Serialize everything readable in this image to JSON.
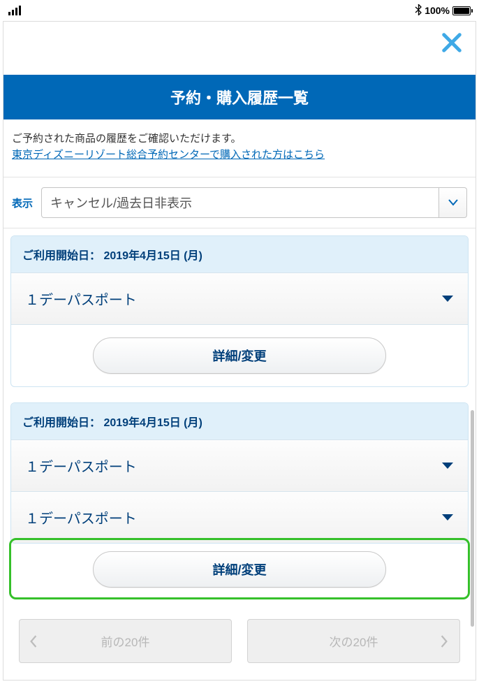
{
  "status": {
    "battery_text": "100%"
  },
  "header": {
    "title": "予約・購入履歴一覧"
  },
  "intro": {
    "text": "ご予約された商品の履歴をご確認いただけます。",
    "link": "東京ディズニーリゾート総合予約センターで購入された方はこちら"
  },
  "filter": {
    "label": "表示",
    "selected": "キャンセル/過去日非表示"
  },
  "bookings": [
    {
      "date_label": "ご利用開始日： 2019年4月15日 (月)",
      "items": [
        "１デーパスポート"
      ],
      "action": "詳細/変更"
    },
    {
      "date_label": "ご利用開始日： 2019年4月15日 (月)",
      "items": [
        "１デーパスポート",
        "１デーパスポート"
      ],
      "action": "詳細/変更"
    }
  ],
  "pager": {
    "prev": "前の20件",
    "next": "次の20件"
  }
}
